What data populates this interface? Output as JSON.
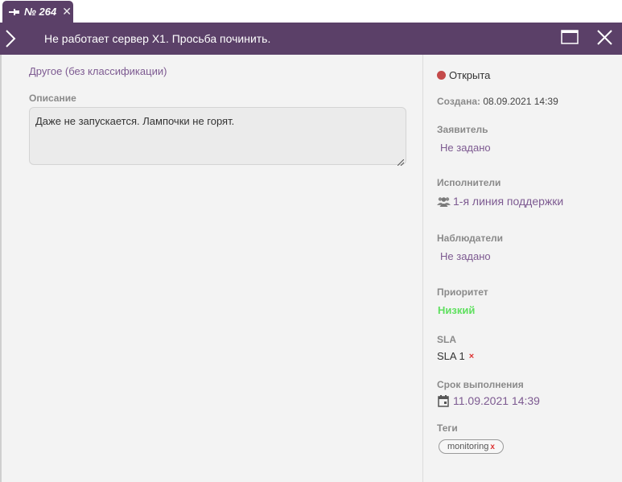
{
  "tab": {
    "label": "№ 264",
    "pin_icon": "pin-icon",
    "close_icon": "close-icon"
  },
  "header": {
    "title": "Не работает сервер X1. Просьба починить.",
    "collapse_icon": "chevron-right-icon",
    "maximize_icon": "maximize-icon",
    "close_icon": "close-icon",
    "color": "#5b4068"
  },
  "main": {
    "category": "Другое (без классификации)",
    "description_label": "Описание",
    "description_text": "Даже не запускается. Лампочки не горят."
  },
  "sidebar": {
    "status": {
      "label": "Открыта",
      "color": "#c44a4a"
    },
    "created": {
      "label": "Создана:",
      "value": "08.09.2021 14:39"
    },
    "requester": {
      "label": "Заявитель",
      "value": "Не задано"
    },
    "executors": {
      "label": "Исполнители",
      "value": "1-я линия поддержки",
      "icon": "users-icon"
    },
    "watchers": {
      "label": "Наблюдатели",
      "value": "Не задано"
    },
    "priority": {
      "label": "Приоритет",
      "value": "Низкий",
      "color": "#5fe05f"
    },
    "sla": {
      "label": "SLA",
      "value": "SLA 1",
      "remove": "×"
    },
    "due": {
      "label": "Срок выполнения",
      "value": "11.09.2021 14:39",
      "icon": "calendar-icon"
    },
    "tags": {
      "label": "Теги",
      "items": [
        {
          "label": "monitoring",
          "remove": "x"
        }
      ]
    }
  }
}
